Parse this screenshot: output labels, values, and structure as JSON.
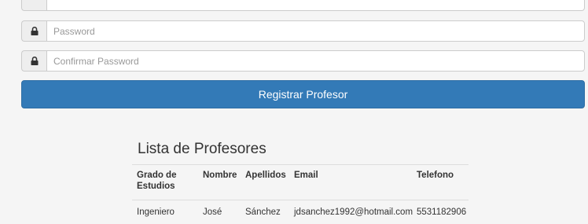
{
  "form": {
    "top_field": {
      "placeholder": ""
    },
    "password": {
      "placeholder": "Password",
      "icon": "lock-icon"
    },
    "confirm_password": {
      "placeholder": "Confirmar Password",
      "icon": "lock-icon"
    },
    "submit_label": "Registrar Profesor"
  },
  "list": {
    "title": "Lista de Profesores",
    "columns": {
      "grado": "Grado de Estudios",
      "nombre": "Nombre",
      "apellidos": "Apellidos",
      "email": "Email",
      "telefono": "Telefono"
    },
    "rows": [
      {
        "grado": "Ingeniero",
        "nombre": "José",
        "apellidos": "Sánchez",
        "email": "jdsanchez1992@hotmail.com",
        "telefono": "5531182906"
      }
    ]
  },
  "colors": {
    "primary": "#337ab7",
    "background": "#f5f5f5",
    "border": "#cccccc"
  }
}
